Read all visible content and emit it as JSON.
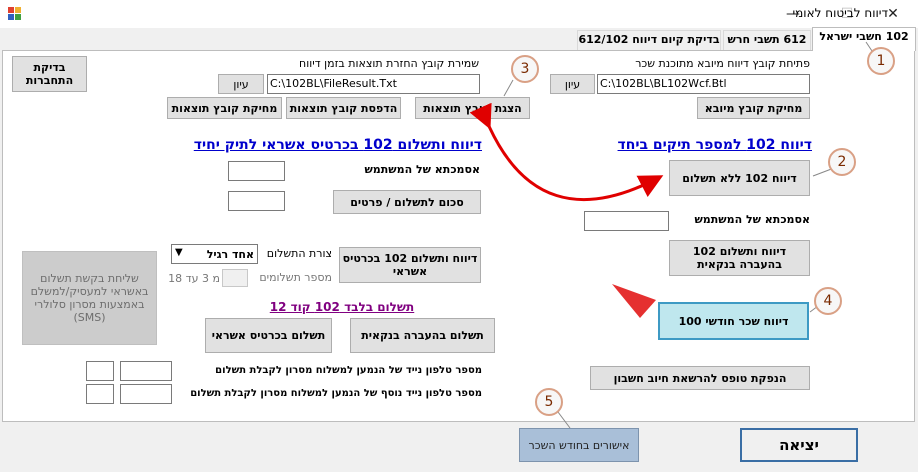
{
  "window": {
    "title": "דיווח לביטוח לאומי",
    "minimize": "—",
    "maximize": "☐",
    "close": "✕"
  },
  "tabs": [
    {
      "label": "102 חשבי ישראל",
      "active": true
    },
    {
      "label": "612 תשבי חרש",
      "active": false
    },
    {
      "label": "בדיקת קיום דיווח 612/102",
      "active": false
    }
  ],
  "left_panel": {
    "connection_check": "בדיקת התחברות",
    "save_file_label": "שמירת קובץ החזרת תוצאות בזמן דיווח",
    "result_path": "C:\\102BL\\FileResult.Txt",
    "browse": "עיון",
    "delete_results": "מחיקת קובץ תוצאות",
    "print_results": "הדפסת קובץ תוצאות",
    "show_results": "הצגת קובץ תוצאות",
    "credit_link": "דיווח ותשלום 102 בכרטיס אשראי לתיק יחיד",
    "user_reference": "אסמכתא של המשתמש",
    "payment_amount": "סכום לתשלום / פרטים",
    "credit_report_button": "דיווח ותשלום 102 בכרטיס אשראי",
    "payment_type_label": "צורת התשלום",
    "payment_type_value": "אחד רגיל",
    "installments_label": "מספר תשלומים",
    "installments_hint": "מ 3 עד 18",
    "sms_button": "שליחת בקשת תשלום באשראי למעסיק/למשלם באמצעות מסרון סלולרי (SMS)",
    "pay_only_link": "תשלום בלבד 102 קוד 12",
    "pay_credit": "תשלום בכרטיס אשראי",
    "pay_bank": "תשלום בהעברה בנקאית",
    "phone1_label": "מספר טלפון נייד של הנמען למשלוח מסרון לקבלת תשלום",
    "phone2_label": "מספר טלפון נייד נוסף של הנמען למשלוח מסרון לקבלת תשלום"
  },
  "right_panel": {
    "import_file_label": "פתיחת קובץ דיווח מיובא מתוכנת שכר",
    "import_path": "C:\\102BL\\BL102Wcf.Btl",
    "browse": "עיון",
    "delete_import": "מחיקת קובץ מיובא",
    "multi_link": "דיווח 102 למספר תיקים ביחד",
    "no_pay_report": "דיווח 102 ללא תשלום",
    "user_reference": "אסמכתא של המשתמש",
    "bank_report": "דיווח ותשלום 102 בהעברה בנקאית",
    "monthly_salary": "דיווח שכר חודשי 100",
    "debit_form": "הנפקת טופס להרשאת חיוב חשבון"
  },
  "bottom": {
    "monthly_approvals": "אישורים בחודש השכר",
    "exit": "יציאה"
  },
  "annotations": [
    "1",
    "2",
    "3",
    "4",
    "5"
  ],
  "colors": {
    "arrow": "#e00000",
    "badge_border": "#d9a085",
    "link": "#0000cc",
    "teal": "#bfe7ee"
  }
}
